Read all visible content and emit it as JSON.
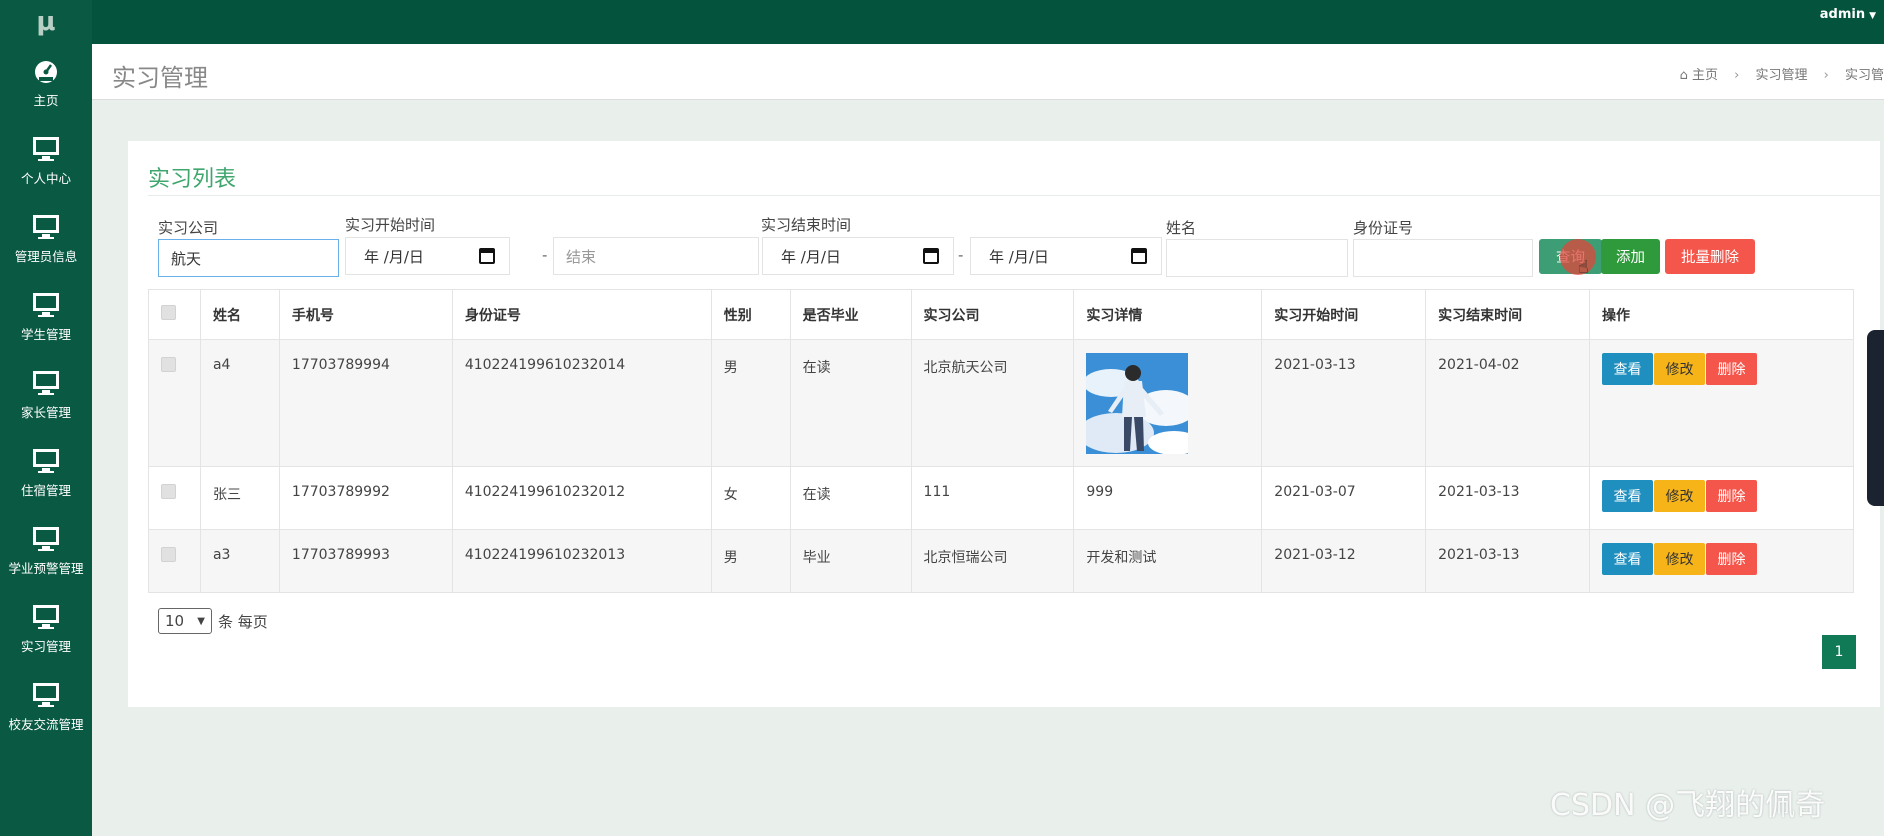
{
  "app": {
    "logo": "μ",
    "user": "admin"
  },
  "sidebar": {
    "items": [
      {
        "label": "主页",
        "icon": "dashboard-icon"
      },
      {
        "label": "个人中心",
        "icon": "monitor-icon"
      },
      {
        "label": "管理员信息",
        "icon": "monitor-icon"
      },
      {
        "label": "学生管理",
        "icon": "monitor-icon"
      },
      {
        "label": "家长管理",
        "icon": "monitor-icon"
      },
      {
        "label": "住宿管理",
        "icon": "monitor-icon"
      },
      {
        "label": "学业预警管理",
        "icon": "monitor-icon"
      },
      {
        "label": "实习管理",
        "icon": "monitor-icon"
      },
      {
        "label": "校友交流管理",
        "icon": "monitor-icon"
      }
    ]
  },
  "header": {
    "title": "实习管理",
    "breadcrumb": [
      "主页",
      "实习管理",
      "实习管"
    ]
  },
  "panel": {
    "title": "实习列表",
    "filters": {
      "company_label": "实习公司",
      "company_value": "航天",
      "start_label": "实习开始时间",
      "start_from": "年 /月/日",
      "start_to_placeholder": "结束",
      "end_label": "实习结束时间",
      "end_from": "年 /月/日",
      "end_to": "年 /月/日",
      "name_label": "姓名",
      "id_label": "身份证号",
      "dash": "-"
    },
    "buttons": {
      "search": "查询",
      "add": "添加",
      "bulk_delete": "批量删除"
    },
    "table": {
      "columns": [
        "姓名",
        "手机号",
        "身份证号",
        "性别",
        "是否毕业",
        "实习公司",
        "实习详情",
        "实习开始时间",
        "实习结束时间",
        "操作"
      ],
      "rows": [
        {
          "name": "a4",
          "phone": "17703789994",
          "id": "410224199610232014",
          "gender": "男",
          "graduated": "在读",
          "company": "北京航天公司",
          "detail": "",
          "start": "2021-03-13",
          "end": "2021-04-02"
        },
        {
          "name": "张三",
          "phone": "17703789992",
          "id": "410224199610232012",
          "gender": "女",
          "graduated": "在读",
          "company": "111",
          "detail": "999",
          "start": "2021-03-07",
          "end": "2021-03-13"
        },
        {
          "name": "a3",
          "phone": "17703789993",
          "id": "410224199610232013",
          "gender": "男",
          "graduated": "毕业",
          "company": "北京恒瑞公司",
          "detail": "开发和测试",
          "start": "2021-03-12",
          "end": "2021-03-13"
        }
      ],
      "actions": {
        "view": "查看",
        "edit": "修改",
        "delete": "删除"
      }
    },
    "pager": {
      "page_size": "10",
      "per_page_text": "条 每页",
      "current_page": "1"
    }
  },
  "watermark": "CSDN @飞翔的佩奇"
}
